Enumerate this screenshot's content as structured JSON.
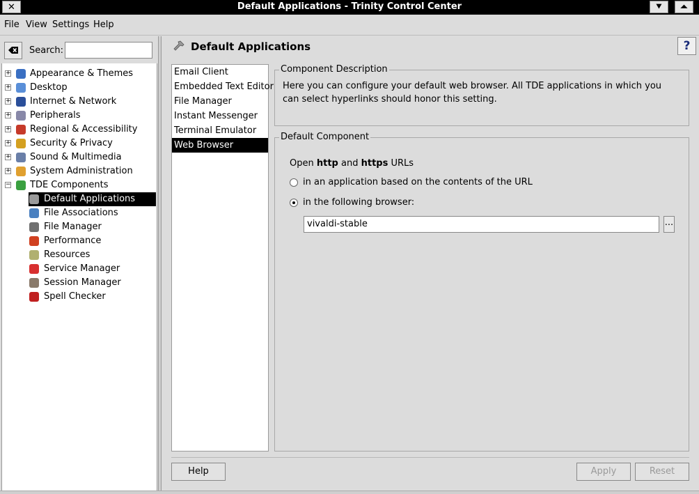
{
  "window": {
    "title": "Default Applications - Trinity Control Center",
    "close_glyph": "✕",
    "minimize_glyph": "⯆",
    "maximize_glyph": "⏶"
  },
  "menubar": [
    {
      "label": "File"
    },
    {
      "label": "View"
    },
    {
      "label": "Settings"
    },
    {
      "label": "Help"
    }
  ],
  "search": {
    "label": "Search:",
    "value": ""
  },
  "tree": {
    "categories": [
      {
        "label": "Appearance & Themes",
        "icon": "appearance-icon",
        "color": "#3a6fc2"
      },
      {
        "label": "Desktop",
        "icon": "desktop-icon",
        "color": "#5a8fd8"
      },
      {
        "label": "Internet & Network",
        "icon": "globe-icon",
        "color": "#2b4f9a"
      },
      {
        "label": "Peripherals",
        "icon": "mouse-icon",
        "color": "#8888a8"
      },
      {
        "label": "Regional & Accessibility",
        "icon": "flag-icon",
        "color": "#c63a2a"
      },
      {
        "label": "Security & Privacy",
        "icon": "key-icon",
        "color": "#d4a020"
      },
      {
        "label": "Sound & Multimedia",
        "icon": "speaker-icon",
        "color": "#6a7fa8"
      },
      {
        "label": "System Administration",
        "icon": "gears-icon",
        "color": "#e0a030"
      },
      {
        "label": "TDE Components",
        "icon": "components-icon",
        "color": "#3aa040"
      }
    ],
    "children": [
      {
        "label": "Default Applications",
        "icon": "wrench-icon",
        "color": "#9a9a9a",
        "selected": true
      },
      {
        "label": "File Associations",
        "icon": "file-associations-icon",
        "color": "#4a80c0"
      },
      {
        "label": "File Manager",
        "icon": "file-manager-icon",
        "color": "#707070"
      },
      {
        "label": "Performance",
        "icon": "rocket-icon",
        "color": "#d04020"
      },
      {
        "label": "Resources",
        "icon": "resources-icon",
        "color": "#b0b070"
      },
      {
        "label": "Service Manager",
        "icon": "pin-icon",
        "color": "#d83030"
      },
      {
        "label": "Session Manager",
        "icon": "session-icon",
        "color": "#8a7a6a"
      },
      {
        "label": "Spell Checker",
        "icon": "spellcheck-icon",
        "color": "#c02020"
      }
    ]
  },
  "right": {
    "title": "Default Applications",
    "help_icon_glyph": "?",
    "components": [
      {
        "label": "Email Client"
      },
      {
        "label": "Embedded Text Editor"
      },
      {
        "label": "File Manager"
      },
      {
        "label": "Instant Messenger"
      },
      {
        "label": "Terminal Emulator"
      },
      {
        "label": "Web Browser",
        "selected": true
      }
    ],
    "description_group": {
      "label": "Component Description",
      "text": "Here you can configure your default web browser. All TDE applications in which you can select hyperlinks should honor this setting."
    },
    "default_group": {
      "label": "Default Component",
      "intro_prefix": "Open ",
      "intro_http": "http",
      "intro_and": " and ",
      "intro_https": "https",
      "intro_suffix": " URLs",
      "option1": "in an application based on the contents of the URL",
      "option2": "in the following browser:",
      "selected_option": 2,
      "browser_value": "vivaldi-stable",
      "browse_button": "..."
    }
  },
  "buttons": {
    "help": "Help",
    "apply": "Apply",
    "reset": "Reset"
  }
}
